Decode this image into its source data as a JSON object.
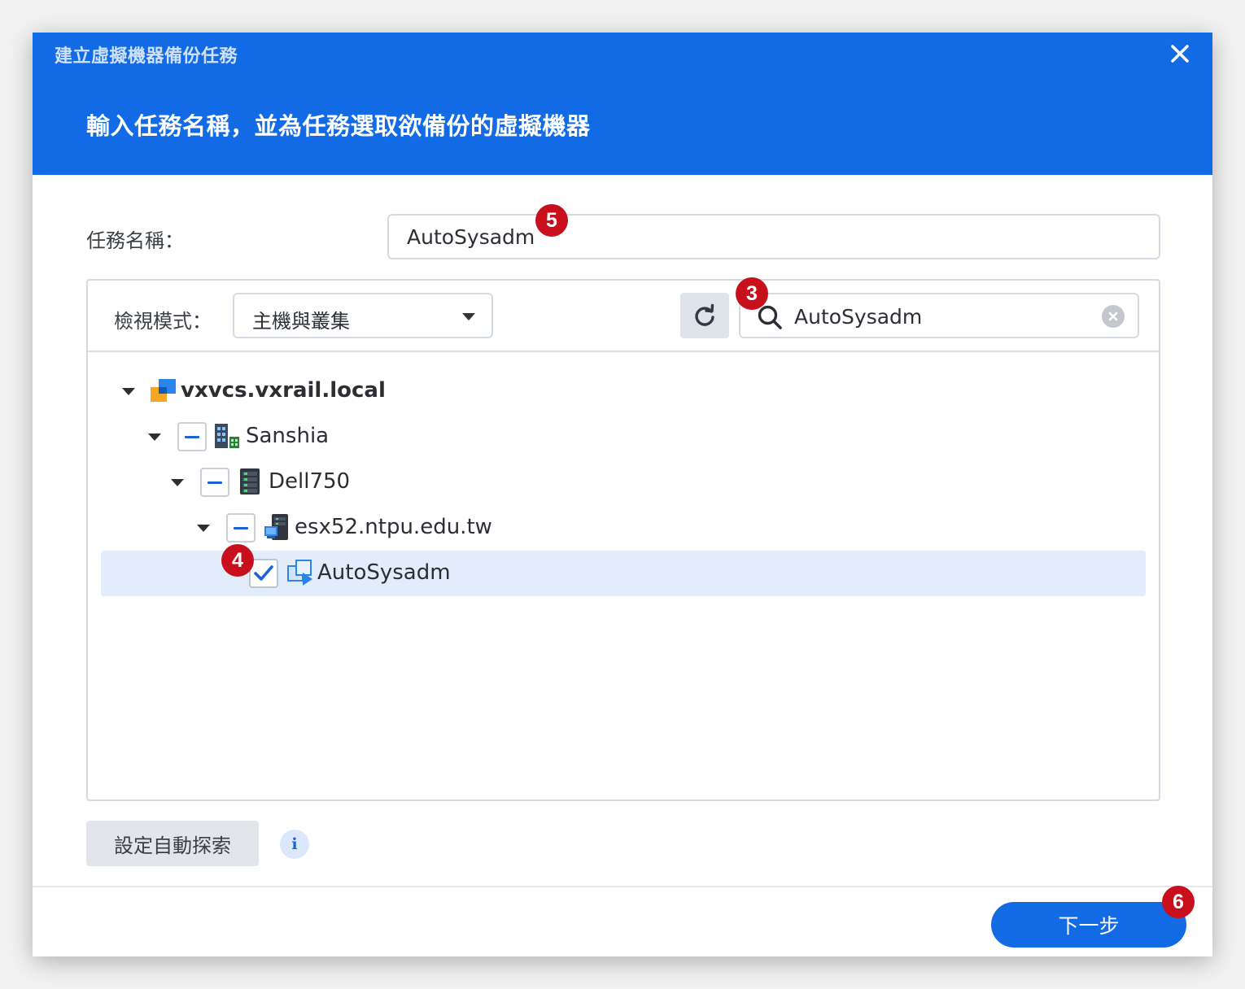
{
  "dialog": {
    "title": "建立虛擬機器備份任務",
    "subtitle": "輸入任務名稱，並為任務選取欲備份的虛擬機器",
    "close_icon": "close-icon"
  },
  "form": {
    "task_name_label": "任務名稱：",
    "task_name_value": "AutoSysadm"
  },
  "toolbar": {
    "view_mode_label": "檢視模式：",
    "view_mode_value": "主機與叢集",
    "search_value": "AutoSysadm"
  },
  "tree": {
    "nodes": [
      {
        "label": "vxvcs.vxrail.local",
        "icon": "vcenter-icon",
        "check": "none",
        "level": 0,
        "expanded": true
      },
      {
        "label": "Sanshia",
        "icon": "datacenter-icon",
        "check": "partial",
        "level": 1,
        "expanded": true
      },
      {
        "label": "Dell750",
        "icon": "cluster-icon",
        "check": "partial",
        "level": 2,
        "expanded": true
      },
      {
        "label": "esx52.ntpu.edu.tw",
        "icon": "host-icon",
        "check": "partial",
        "level": 3,
        "expanded": true
      },
      {
        "label": "AutoSysadm",
        "icon": "vm-icon",
        "check": "checked",
        "level": 4,
        "selected": true
      }
    ]
  },
  "footer": {
    "auto_discover_label": "設定自動探索",
    "next_label": "下一步"
  },
  "annotations": {
    "badge_3": "3",
    "badge_4": "4",
    "badge_5": "5",
    "badge_6": "6"
  },
  "colors": {
    "header": "#126be5",
    "selection": "#e3ecfa",
    "badge": "#c8101d"
  }
}
